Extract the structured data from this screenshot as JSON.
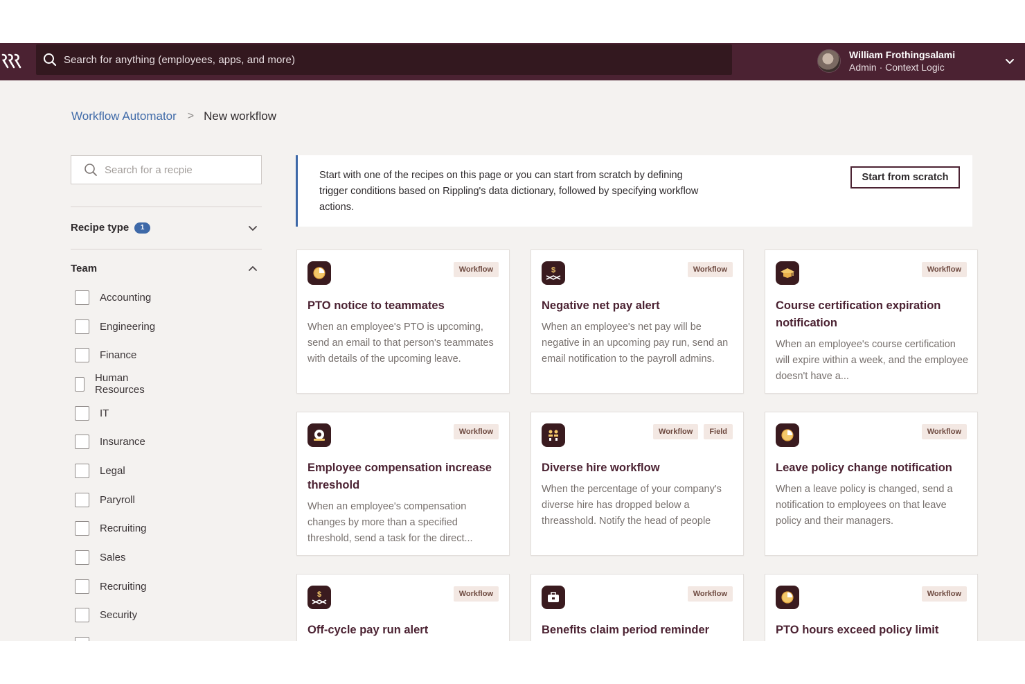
{
  "topbar": {
    "search_placeholder": "Search for anything (employees, apps, and more)",
    "user_name": "William Frothingsalami",
    "user_role": "Admin · Context Logic"
  },
  "breadcrumb": {
    "parent": "Workflow Automator",
    "separator": ">",
    "current": "New workflow"
  },
  "sidebar": {
    "search_placeholder": "Search for a recpie",
    "recipe_type_label": "Recipe type",
    "recipe_type_count": "1",
    "team_label": "Team",
    "team_items": [
      "Accounting",
      "Engineering",
      "Finance",
      "Human Resources",
      "IT",
      "Insurance",
      "Legal",
      "Paryroll",
      "Recruiting",
      "Sales",
      "Recruiting",
      "Security"
    ]
  },
  "intro": {
    "text": "Start with one of the  recipes on this page or you can start from scratch by defining trigger conditions based on Rippling's data dictionary, followed by specifying workflow actions.",
    "button": "Start from scratch"
  },
  "cards": [
    {
      "icon": "pto-icon",
      "tags": [
        "Workflow"
      ],
      "title": "PTO notice to teammates",
      "desc": "When an employee's PTO is upcoming, send an email to that person's teammates with details of the upcoming leave."
    },
    {
      "icon": "payroll-icon",
      "tags": [
        "Workflow"
      ],
      "title": "Negative net pay alert",
      "desc": "When an employee's net pay will be negative in an upcoming pay run, send an email notification to the payroll admins."
    },
    {
      "icon": "learning-icon",
      "tags": [
        "Workflow"
      ],
      "title": "Course certification expiration notification",
      "desc": "When an employee's course certification will expire within a week, and the employee doesn't have a..."
    },
    {
      "icon": "compensation-icon",
      "tags": [
        "Workflow"
      ],
      "title": "Employee compensation increase threshold",
      "desc": "When an employee's compensation changes by more than a specified threshold, send a task for the direct..."
    },
    {
      "icon": "diversity-icon",
      "tags": [
        "Workflow",
        "Field"
      ],
      "title": "Diverse hire workflow",
      "desc": "When the percentage of your company's diverse hire has dropped below a threasshold. Notify the head of people"
    },
    {
      "icon": "pto-icon",
      "tags": [
        "Workflow"
      ],
      "title": "Leave policy change notification",
      "desc": "When a leave policy is changed, send a notification to employees on that leave policy and their managers."
    },
    {
      "icon": "payroll-icon",
      "tags": [
        "Workflow"
      ],
      "title": "Off-cycle pay run alert",
      "desc": ""
    },
    {
      "icon": "benefits-icon",
      "tags": [
        "Workflow"
      ],
      "title": "Benefits claim period reminder",
      "desc": ""
    },
    {
      "icon": "pto-icon",
      "tags": [
        "Workflow"
      ],
      "title": "PTO hours exceed policy limit",
      "desc": ""
    }
  ],
  "colors": {
    "topbar": "#4b2232",
    "accent_blue": "#3e69a8",
    "card_title": "#4b2232"
  }
}
